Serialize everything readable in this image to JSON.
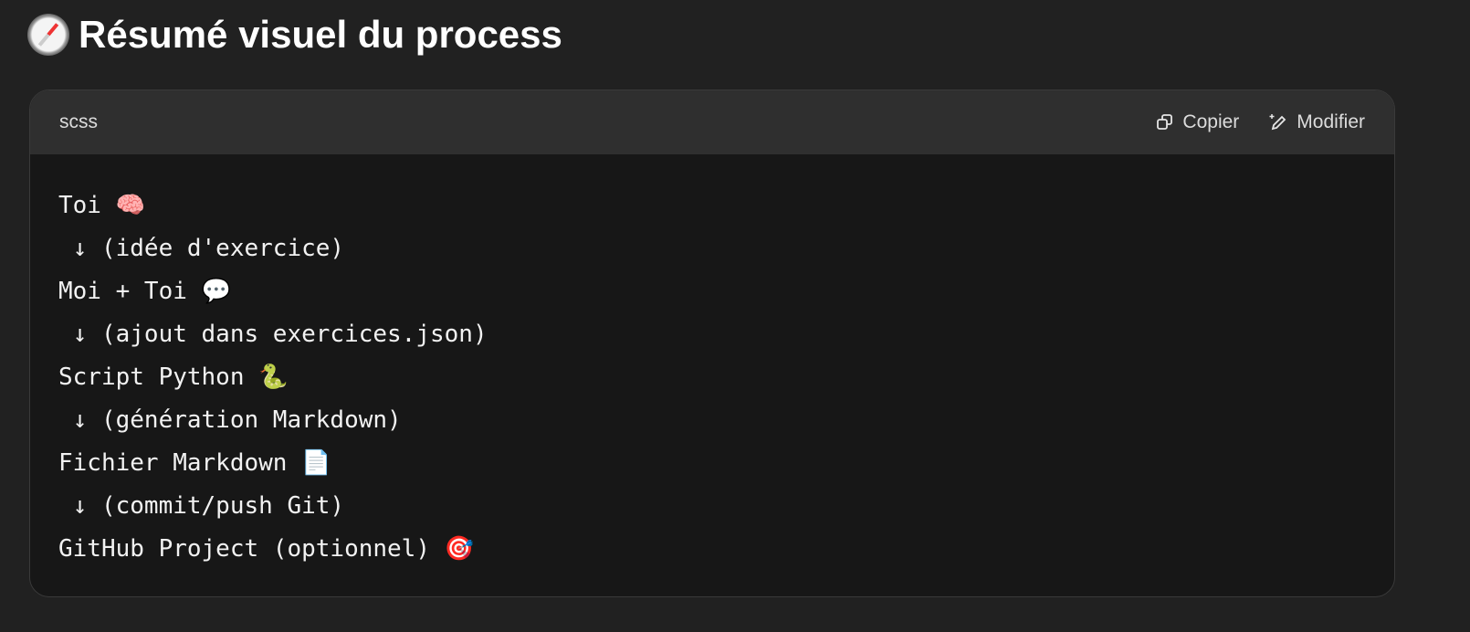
{
  "heading": {
    "icon": "compass-icon",
    "text": "Résumé visuel du process"
  },
  "code_block": {
    "language": "scss",
    "copy_label": "Copier",
    "edit_label": "Modifier",
    "lines": [
      "Toi 🧠",
      " ↓ (idée d'exercice)",
      "Moi + Toi 💬",
      " ↓ (ajout dans exercices.json)",
      "Script Python 🐍",
      " ↓ (génération Markdown)",
      "Fichier Markdown 📄",
      " ↓ (commit/push Git)",
      "GitHub Project (optionnel) 🎯"
    ]
  }
}
